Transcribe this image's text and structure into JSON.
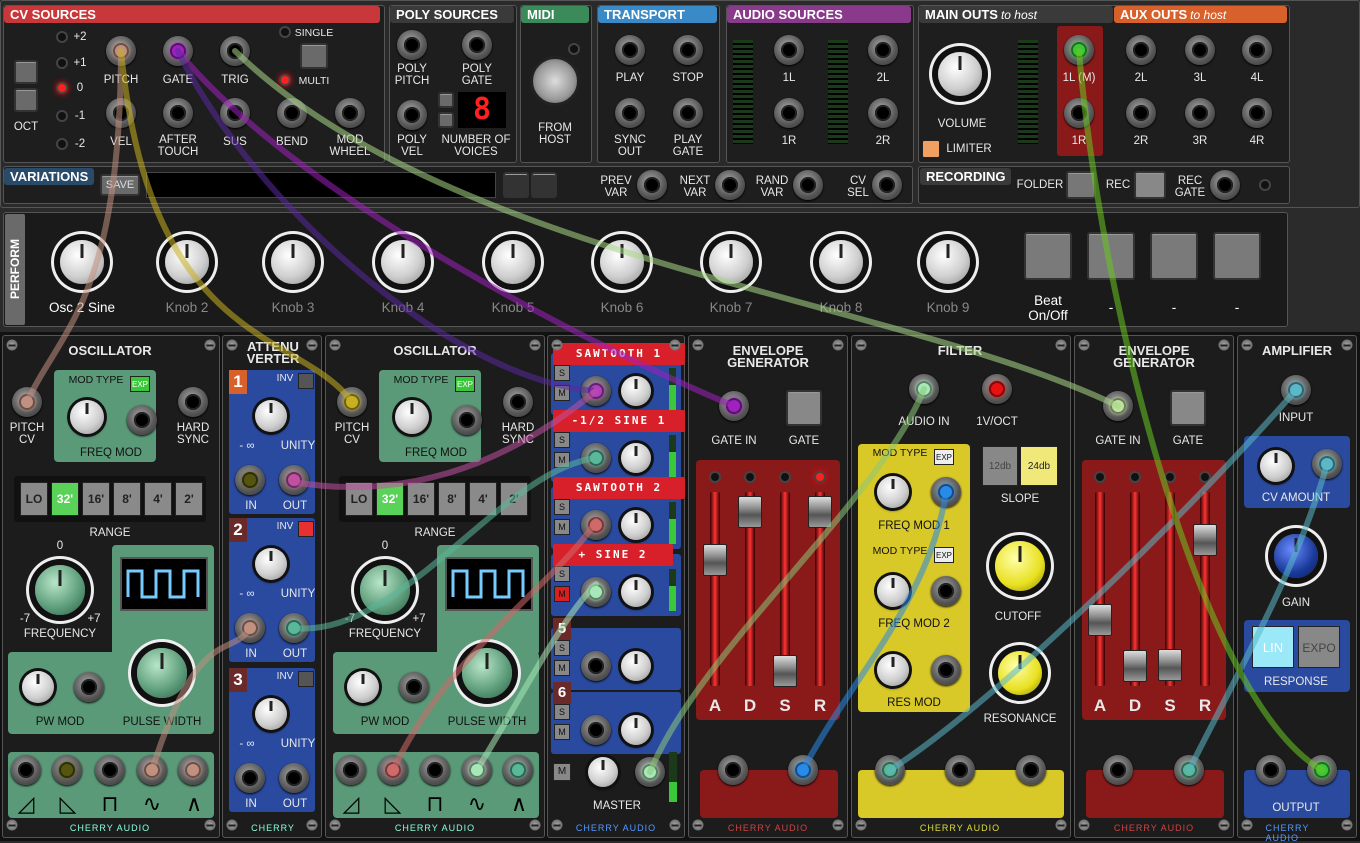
{
  "header": {
    "cv_sources": "CV SOURCES",
    "poly_sources": "POLY SOURCES",
    "midi": "MIDI",
    "transport": "TRANSPORT",
    "audio_sources": "AUDIO SOURCES",
    "main_outs": "MAIN OUTS",
    "main_outs_sub": "to host",
    "aux_outs": "AUX OUTS",
    "aux_outs_sub": "to host",
    "oct": "OCT",
    "oct_values": [
      "+2",
      "+1",
      "0",
      "-1",
      "-2"
    ],
    "single": "SINGLE",
    "multi": "MULTI",
    "cv_jacks": {
      "pitch": "PITCH",
      "gate": "GATE",
      "trig": "TRIG",
      "vel": "VEL",
      "after_touch": "AFTER TOUCH",
      "sus": "SUS",
      "bend": "BEND",
      "mod_wheel": "MOD WHEEL"
    },
    "poly": {
      "poly_pitch": "POLY PITCH",
      "poly_gate": "POLY GATE",
      "poly_vel": "POLY VEL",
      "number_of_voices": "NUMBER OF VOICES",
      "voices": "8"
    },
    "from_host": "FROM HOST",
    "transport_jacks": {
      "play": "PLAY",
      "stop": "STOP",
      "sync_out": "SYNC OUT",
      "play_gate": "PLAY GATE"
    },
    "audio": {
      "l1": "1L",
      "l2": "2L",
      "r1": "1R",
      "r2": "2R"
    },
    "volume": "VOLUME",
    "limiter": "LIMITER",
    "main_jacks": {
      "l1m": "1L (M)",
      "r1": "1R"
    },
    "aux": {
      "l2": "2L",
      "l3": "3L",
      "l4": "4L",
      "r2": "2R",
      "r3": "3R",
      "r4": "4R"
    },
    "variations": "VARIATIONS",
    "save": "SAVE",
    "var_jacks": {
      "prev": "PREV VAR",
      "next": "NEXT VAR",
      "rand": "RAND VAR",
      "cv_sel": "CV SEL"
    },
    "recording": "RECORDING",
    "folder": "FOLDER",
    "rec": "REC",
    "rec_gate": "REC GATE"
  },
  "perform": {
    "title": "PERFORM",
    "knobs": [
      "Osc 2 Sine",
      "Knob 2",
      "Knob 3",
      "Knob 4",
      "Knob 5",
      "Knob 6",
      "Knob 7",
      "Knob 8",
      "Knob 9"
    ],
    "buttons": [
      "Beat On/Off",
      "-",
      "-",
      "-"
    ]
  },
  "osc1": {
    "title": "OSCILLATOR",
    "pitch_cv": "PITCH CV",
    "mod_type": "MOD TYPE",
    "exp": "EXP",
    "freq_mod": "FREQ MOD",
    "hard_sync": "HARD SYNC",
    "range": [
      "LO",
      "32'",
      "16'",
      "8'",
      "4'",
      "2'"
    ],
    "range_label": "RANGE",
    "freq_zero": "0",
    "freq_min": "-7",
    "freq_max": "+7",
    "frequency": "FREQUENCY",
    "pw_mod": "PW MOD",
    "pulse_width": "PULSE WIDTH",
    "brand": "CHERRY AUDIO"
  },
  "atten": {
    "title": "ATTENU VERTER",
    "inv": "INV",
    "ch": [
      "1",
      "2",
      "3"
    ],
    "minus_inf": "- ∞",
    "unity": "UNITY",
    "in": "IN",
    "out": "OUT",
    "brand": "CHERRY"
  },
  "osc2": {
    "title": "OSCILLATOR",
    "pitch_cv": "PITCH CV",
    "mod_type": "MOD TYPE",
    "exp": "EXP",
    "freq_mod": "FREQ MOD",
    "hard_sync": "HARD SYNC",
    "range": [
      "LO",
      "32'",
      "16'",
      "8'",
      "4'",
      "2'"
    ],
    "range_label": "RANGE",
    "freq_zero": "0",
    "freq_min": "-7",
    "freq_max": "+7",
    "frequency": "FREQUENCY",
    "pw_mod": "PW MOD",
    "pulse_width": "PULSE WIDTH",
    "brand": "CHERRY AUDIO"
  },
  "mixer": {
    "channels": [
      "SAWTOOTH 1",
      "-1/2 SINE 1",
      "SAWTOOTH 2",
      "+ SINE 2",
      "5",
      "6"
    ],
    "s": "S",
    "m": "M",
    "master": "MASTER",
    "brand": "CHERRY AUDIO"
  },
  "env1": {
    "title": "ENVELOPE GENERATOR",
    "gate_in": "GATE IN",
    "gate": "GATE",
    "adsr": [
      "A",
      "D",
      "S",
      "R"
    ],
    "brand": "CHERRY AUDIO"
  },
  "filter": {
    "title": "FILTER",
    "audio_in": "AUDIO IN",
    "v_oct": "1V/OCT",
    "mod_type": "MOD TYPE",
    "exp": "EXP",
    "freq_mod1": "FREQ MOD 1",
    "freq_mod2": "FREQ MOD 2",
    "res_mod": "RES MOD",
    "slope_12": "12db",
    "slope_24": "24db",
    "slope": "SLOPE",
    "cutoff": "CUTOFF",
    "resonance": "RESONANCE",
    "brand": "CHERRY AUDIO"
  },
  "env2": {
    "title": "ENVELOPE GENERATOR",
    "gate_in": "GATE IN",
    "gate": "GATE",
    "adsr": [
      "A",
      "D",
      "S",
      "R"
    ],
    "brand": "CHERRY AUDIO"
  },
  "amp": {
    "title": "AMPLIFIER",
    "input": "INPUT",
    "cv_amount": "CV AMOUNT",
    "gain": "GAIN",
    "lin": "LIN",
    "expo": "EXPO",
    "response": "RESPONSE",
    "output": "OUTPUT",
    "brand": "CHERRY AUDIO"
  },
  "colors": {
    "cv": "#c8383a",
    "poly": "#3a3a3a",
    "midi": "#3a8a5a",
    "transport": "#3a8ac8",
    "audio": "#8a3a8a",
    "main": "#3a3a3a",
    "aux": "#d8602a",
    "green_panel": "#5a9a78",
    "yellow_panel": "#d8c828",
    "blue_panel": "#2a4aa0"
  }
}
